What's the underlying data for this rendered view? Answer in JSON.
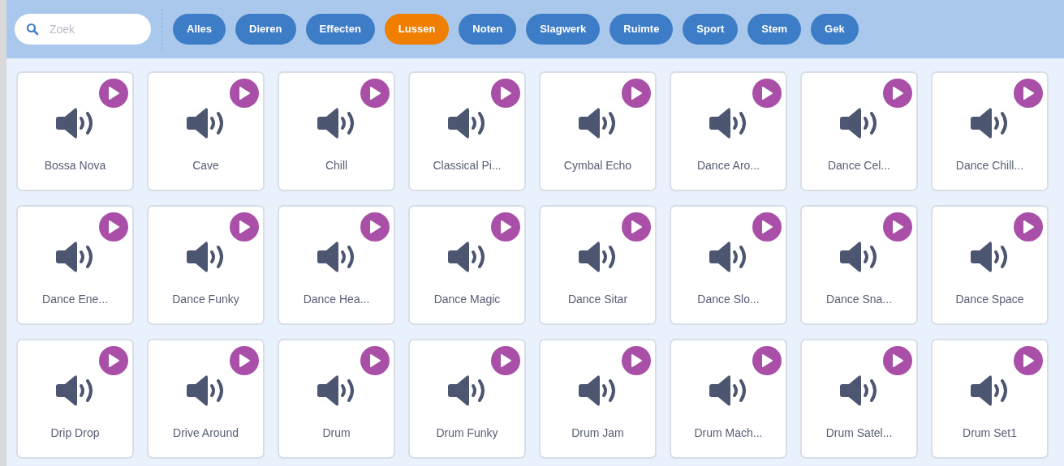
{
  "search": {
    "placeholder": "Zoek"
  },
  "categories": [
    {
      "label": "Alles",
      "selected": false
    },
    {
      "label": "Dieren",
      "selected": false
    },
    {
      "label": "Effecten",
      "selected": false
    },
    {
      "label": "Lussen",
      "selected": true
    },
    {
      "label": "Noten",
      "selected": false
    },
    {
      "label": "Slagwerk",
      "selected": false
    },
    {
      "label": "Ruimte",
      "selected": false
    },
    {
      "label": "Sport",
      "selected": false
    },
    {
      "label": "Stem",
      "selected": false
    },
    {
      "label": "Gek",
      "selected": false
    }
  ],
  "sounds": [
    {
      "name": "Bossa Nova"
    },
    {
      "name": "Cave"
    },
    {
      "name": "Chill"
    },
    {
      "name": "Classical Pi..."
    },
    {
      "name": "Cymbal Echo"
    },
    {
      "name": "Dance Aro..."
    },
    {
      "name": "Dance Cel..."
    },
    {
      "name": "Dance Chill..."
    },
    {
      "name": "Dance Ene..."
    },
    {
      "name": "Dance Funky"
    },
    {
      "name": "Dance Hea..."
    },
    {
      "name": "Dance Magic"
    },
    {
      "name": "Dance Sitar"
    },
    {
      "name": "Dance Slo..."
    },
    {
      "name": "Dance Sna..."
    },
    {
      "name": "Dance Space"
    },
    {
      "name": "Drip Drop"
    },
    {
      "name": "Drive Around"
    },
    {
      "name": "Drum"
    },
    {
      "name": "Drum Funky"
    },
    {
      "name": "Drum Jam"
    },
    {
      "name": "Drum Mach..."
    },
    {
      "name": "Drum Satel..."
    },
    {
      "name": "Drum Set1"
    }
  ]
}
